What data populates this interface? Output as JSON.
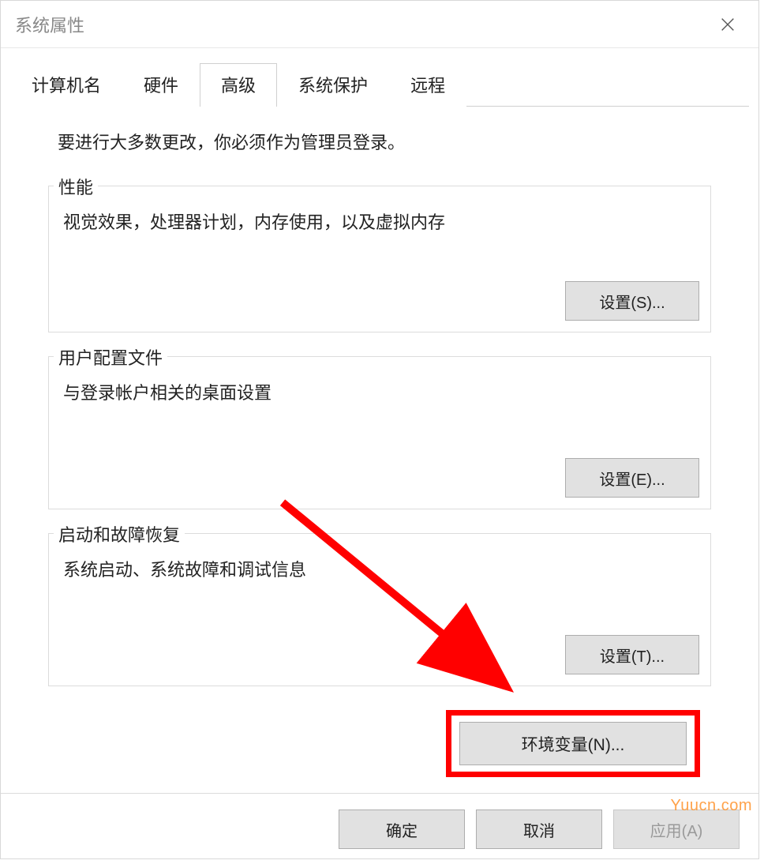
{
  "dialog": {
    "title": "系统属性"
  },
  "tabs": [
    {
      "label": "计算机名",
      "active": false
    },
    {
      "label": "硬件",
      "active": false
    },
    {
      "label": "高级",
      "active": true
    },
    {
      "label": "系统保护",
      "active": false
    },
    {
      "label": "远程",
      "active": false
    }
  ],
  "admin_note": "要进行大多数更改，你必须作为管理员登录。",
  "groups": {
    "performance": {
      "legend": "性能",
      "desc": "视觉效果，处理器计划，内存使用，以及虚拟内存",
      "button": "设置(S)..."
    },
    "user_profile": {
      "legend": "用户配置文件",
      "desc": "与登录帐户相关的桌面设置",
      "button": "设置(E)..."
    },
    "startup": {
      "legend": "启动和故障恢复",
      "desc": "系统启动、系统故障和调试信息",
      "button": "设置(T)..."
    }
  },
  "env_button": "环境变量(N)...",
  "footer": {
    "ok": "确定",
    "cancel": "取消",
    "apply": "应用(A)"
  },
  "watermark": "Yuucn.com"
}
